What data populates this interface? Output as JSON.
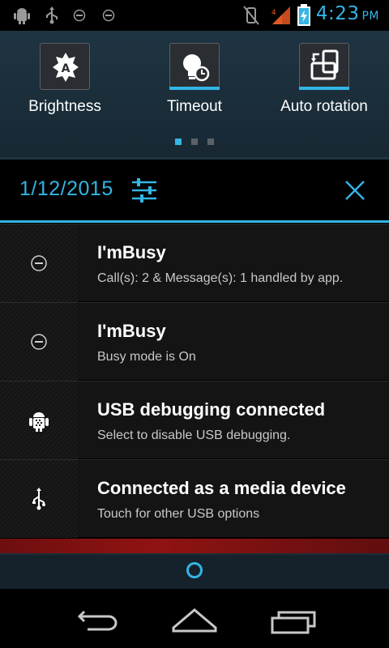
{
  "status_bar": {
    "time": "4:23",
    "ampm": "PM",
    "icons": [
      "android-debug-icon",
      "usb-icon",
      "busy-icon",
      "busy-icon",
      "mute-icon",
      "signal-icon",
      "battery-charging-icon"
    ]
  },
  "quick_settings": {
    "tiles": [
      {
        "label": "Brightness",
        "icon": "brightness-auto-icon"
      },
      {
        "label": "Timeout",
        "icon": "timeout-icon"
      },
      {
        "label": "Auto rotation",
        "icon": "auto-rotation-icon"
      }
    ],
    "page_count": 3,
    "active_page": 1
  },
  "date_row": {
    "date": "1/12/2015",
    "settings_icon": "settings-sliders-icon",
    "close_icon": "close-icon"
  },
  "notifications": [
    {
      "icon": "busy-icon",
      "title": "I'mBusy",
      "text": "Call(s): 2 & Message(s): 1 handled by app."
    },
    {
      "icon": "busy-icon",
      "title": "I'mBusy",
      "text": "Busy mode is On"
    },
    {
      "icon": "android-debug-icon",
      "title": "USB debugging connected",
      "text": "Select to disable USB debugging."
    },
    {
      "icon": "usb-icon",
      "title": "Connected as a media device",
      "text": "Touch for other USB options"
    }
  ],
  "navigation": {
    "buttons": [
      "back-icon",
      "home-icon",
      "recents-icon"
    ]
  },
  "colors": {
    "accent": "#33b5e5",
    "panel": "#172833",
    "notification_bg": "#141414"
  }
}
